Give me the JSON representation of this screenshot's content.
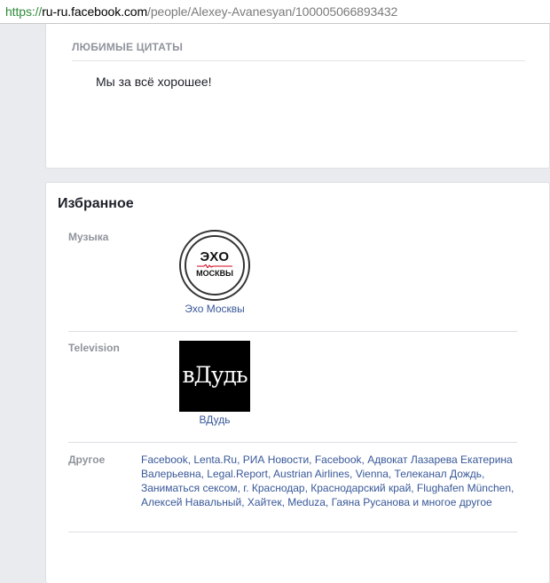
{
  "browser": {
    "url_protocol": "https://",
    "url_host": "ru-ru.facebook.com",
    "url_path": "/people/Alexey-Avanesyan/100005066893432"
  },
  "quotes": {
    "heading": "ЛЮБИМЫЕ ЦИТАТЫ",
    "text": "Мы за всё хорошее!"
  },
  "favorites": {
    "title": "Избранное",
    "music": {
      "label": "Музыка",
      "item_name": "Эхо Москвы",
      "logo_word": "ЭХО",
      "logo_sub": "МОСКВЫ"
    },
    "television": {
      "label": "Television",
      "item_name": "ВДудь",
      "logo_text": "вДудь"
    },
    "other": {
      "label": "Другое",
      "text": "Facebook, Lenta.Ru, РИА Новости, Facebook, Адвокат Лазарева Екатерина Валерьевна, Legal.Report, Austrian Airlines, Vienna, Телеканал Дождь, Заниматься сексом, г. Краснодар, Краснодарский край, Flughafen München, Алексей Навальный, Хайтек, Meduza, Гаяна Русанова и многое другое"
    }
  },
  "colors": {
    "link": "#385898",
    "label_gray": "#90949c",
    "page_bg": "#e9ebee",
    "echo_red": "#d0021b"
  }
}
